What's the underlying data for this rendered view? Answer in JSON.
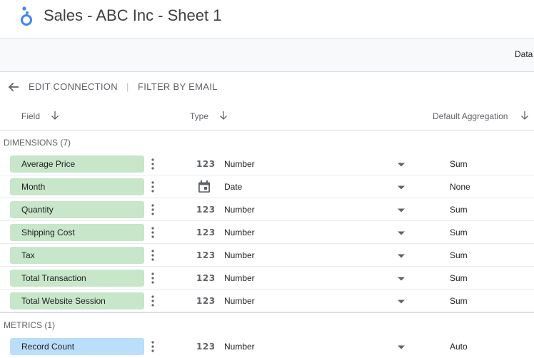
{
  "header": {
    "title": "Sales - ABC Inc - Sheet 1"
  },
  "toolbar": {
    "data_label": "Data"
  },
  "subbar": {
    "edit_connection": "EDIT CONNECTION",
    "separator": "|",
    "filter_by_email": "FILTER BY EMAIL"
  },
  "columns": {
    "field": "Field",
    "type": "Type",
    "aggregation": "Default Aggregation"
  },
  "dimensions": {
    "title": "DIMENSIONS (7)",
    "rows": [
      {
        "name": "Average Price",
        "type_glyph": "123",
        "type": "Number",
        "aggregation": "Sum"
      },
      {
        "name": "Month",
        "type_glyph": "calendar-icon",
        "type": "Date",
        "aggregation": "None"
      },
      {
        "name": "Quantity",
        "type_glyph": "123",
        "type": "Number",
        "aggregation": "Sum"
      },
      {
        "name": "Shipping Cost",
        "type_glyph": "123",
        "type": "Number",
        "aggregation": "Sum"
      },
      {
        "name": "Tax",
        "type_glyph": "123",
        "type": "Number",
        "aggregation": "Sum"
      },
      {
        "name": "Total Transaction",
        "type_glyph": "123",
        "type": "Number",
        "aggregation": "Sum"
      },
      {
        "name": "Total Website Session",
        "type_glyph": "123",
        "type": "Number",
        "aggregation": "Sum"
      }
    ]
  },
  "metrics": {
    "title": "METRICS (1)",
    "rows": [
      {
        "name": "Record Count",
        "type_glyph": "123",
        "type": "Number",
        "aggregation": "Auto"
      }
    ]
  },
  "colors": {
    "dimension_chip": "#c8e6c9",
    "metric_chip": "#bbdefb",
    "logo_blue": "#4285f4"
  }
}
